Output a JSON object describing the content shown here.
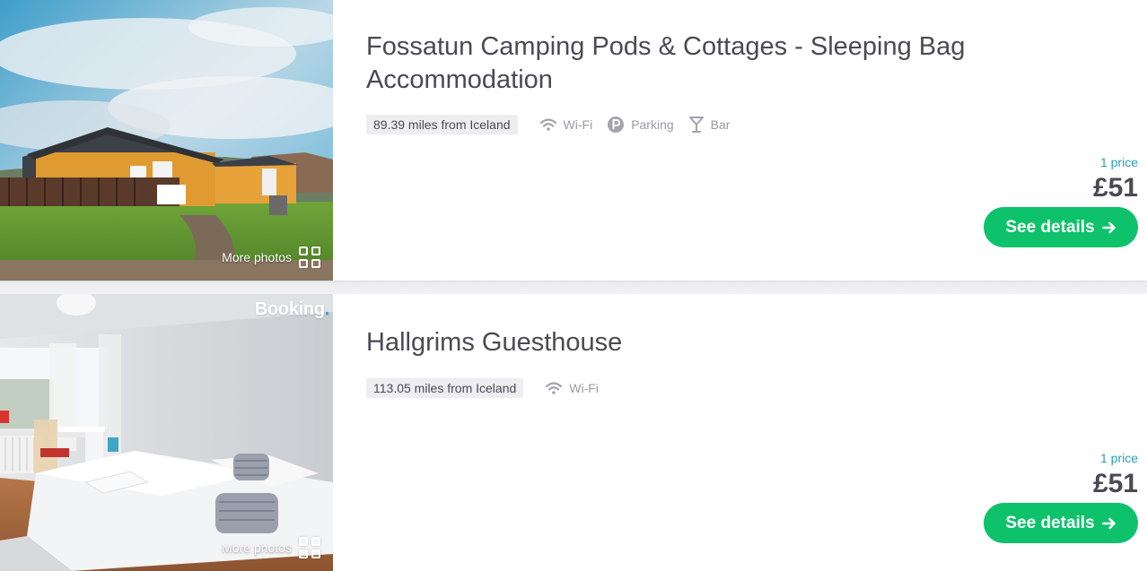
{
  "listings": [
    {
      "title": "Fossatun Camping Pods & Cottages - Sleeping Bag Accommodation",
      "distance": "89.39 miles from Iceland",
      "amenities": [
        {
          "icon": "wifi-icon",
          "label": "Wi-Fi"
        },
        {
          "icon": "parking-icon",
          "label": "Parking"
        },
        {
          "icon": "cocktail-icon",
          "label": "Bar"
        }
      ],
      "more_photos": "More photos",
      "price_count": "1 price",
      "price": "£51",
      "cta": "See details"
    },
    {
      "title": "Hallgrims Guesthouse",
      "distance": "113.05 miles from Iceland",
      "amenities": [
        {
          "icon": "wifi-icon",
          "label": "Wi-Fi"
        }
      ],
      "brand_badge": "Booking",
      "brand_dot": ".",
      "more_photos": "More photos",
      "price_count": "1 price",
      "price": "£51",
      "cta": "See details"
    }
  ],
  "colors": {
    "cta_green": "#0dc26a",
    "price_count_teal": "#2a9fbc",
    "amenity_gray": "#9a9aa6",
    "title_text": "#4a4a55"
  }
}
